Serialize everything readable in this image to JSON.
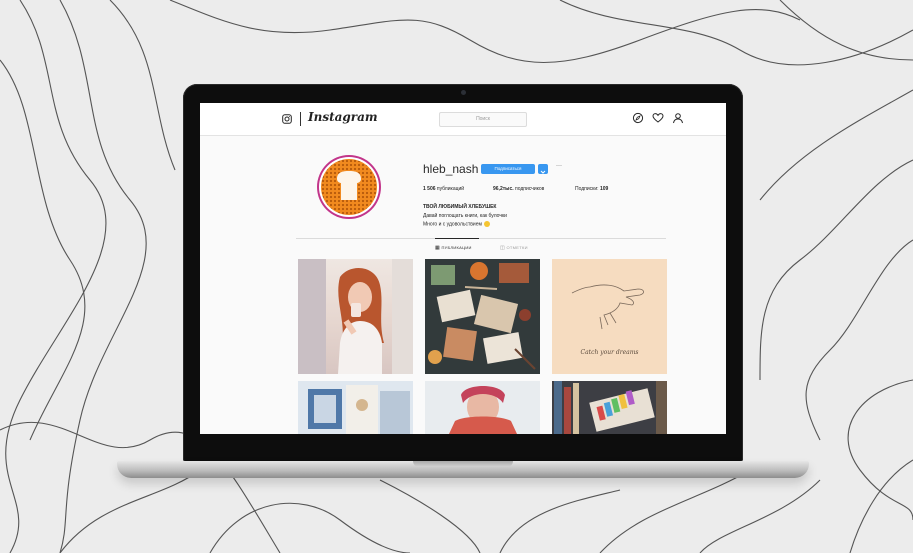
{
  "header": {
    "wordmark": "Instagram",
    "search_placeholder": "Поиск",
    "icons": [
      "explore-icon",
      "heart-icon",
      "profile-icon"
    ]
  },
  "profile": {
    "username": "hleb_nash",
    "follow_label": "Подписаться",
    "more_label": "···",
    "stats": {
      "posts_count": "1 506",
      "posts_label": "публикаций",
      "followers_count": "96,2тыс.",
      "followers_label": "подписчиков",
      "following_label": "Подписки:",
      "following_count": "109"
    },
    "bio": {
      "name": "ТВОЙ ЛЮБИМЫЙ ХЛЕБУШЕК",
      "line1": "Давай поглощать книги, как булочки",
      "line2": "Много и с удовольствием"
    }
  },
  "tabs": [
    "ПУБЛИКАЦИИ",
    "ОТМЕТКИ"
  ],
  "posts": [
    {
      "name": "post-mirror-selfie"
    },
    {
      "name": "post-flatlay-books"
    },
    {
      "name": "post-hand-drawing",
      "caption": "Catch your dreams"
    },
    {
      "name": "post-fabric-books"
    },
    {
      "name": "post-scarf-portrait"
    },
    {
      "name": "post-bookshelf"
    }
  ],
  "colors": {
    "accent": "#3897f0",
    "avatar_ring": "#c2358a",
    "avatar_fill": "#f18a1f"
  }
}
